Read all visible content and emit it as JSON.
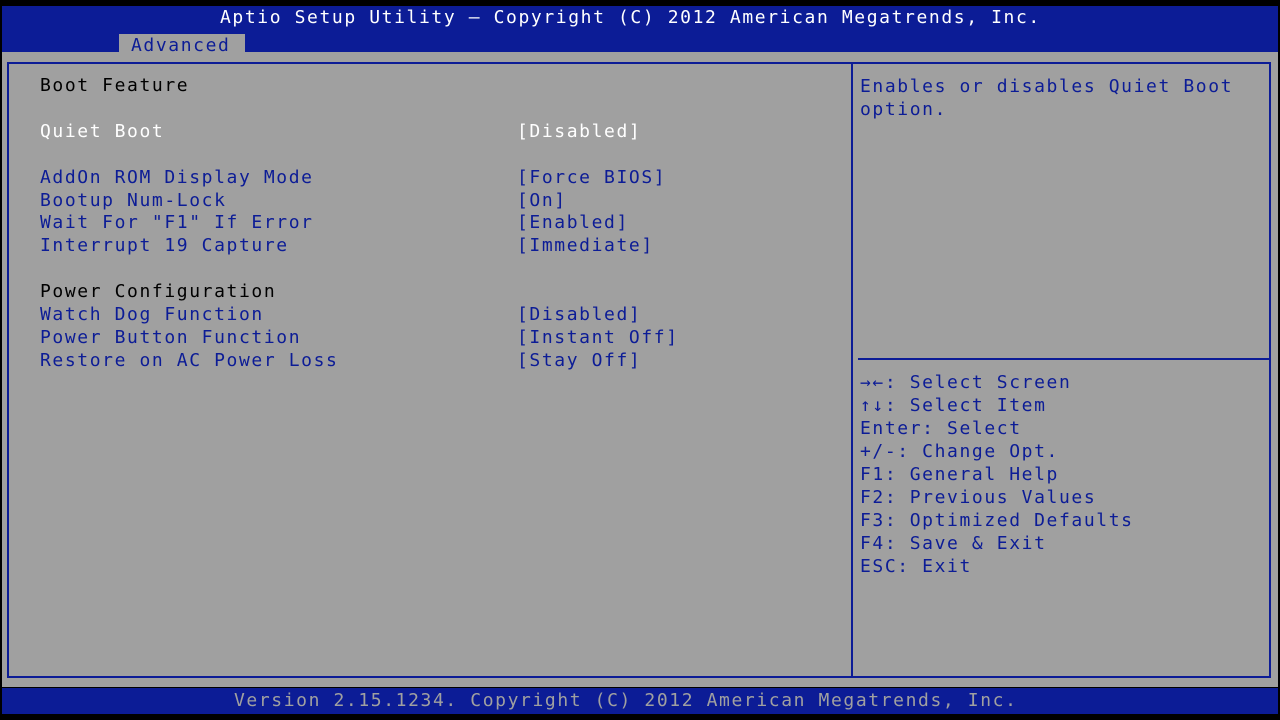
{
  "header": {
    "title": "Aptio Setup Utility – Copyright (C) 2012 American Megatrends, Inc.",
    "tabs": [
      {
        "label": "Advanced",
        "active": true
      }
    ]
  },
  "main": {
    "boot_section_title": "Boot Feature",
    "boot_items": [
      {
        "label": "Quiet Boot",
        "value": "[Disabled]",
        "selected": true
      },
      {
        "label": "AddOn ROM Display Mode",
        "value": "[Force BIOS]"
      },
      {
        "label": "Bootup Num-Lock",
        "value": "[On]"
      },
      {
        "label": "Wait For \"F1\" If Error",
        "value": "[Enabled]"
      },
      {
        "label": "Interrupt 19 Capture",
        "value": "[Immediate]"
      }
    ],
    "power_section_title": "Power Configuration",
    "power_items": [
      {
        "label": "Watch Dog Function",
        "value": "[Disabled]"
      },
      {
        "label": "Power Button Function",
        "value": "[Instant Off]"
      },
      {
        "label": "Restore on AC Power Loss",
        "value": "[Stay Off]"
      }
    ]
  },
  "help": {
    "text": "Enables or disables Quiet Boot option."
  },
  "keys": [
    "→←: Select Screen",
    "↑↓: Select Item",
    "Enter: Select",
    "+/-: Change Opt.",
    "F1: General Help",
    "F2: Previous Values",
    "F3: Optimized Defaults",
    "F4: Save & Exit",
    "ESC: Exit"
  ],
  "footer": {
    "text": "Version 2.15.1234. Copyright (C) 2012 American Megatrends, Inc."
  },
  "colors": {
    "bios_blue": "#0c1c96",
    "panel_gray": "#a0a0a0",
    "selected_white": "#ffffff",
    "section_black": "#000000"
  }
}
